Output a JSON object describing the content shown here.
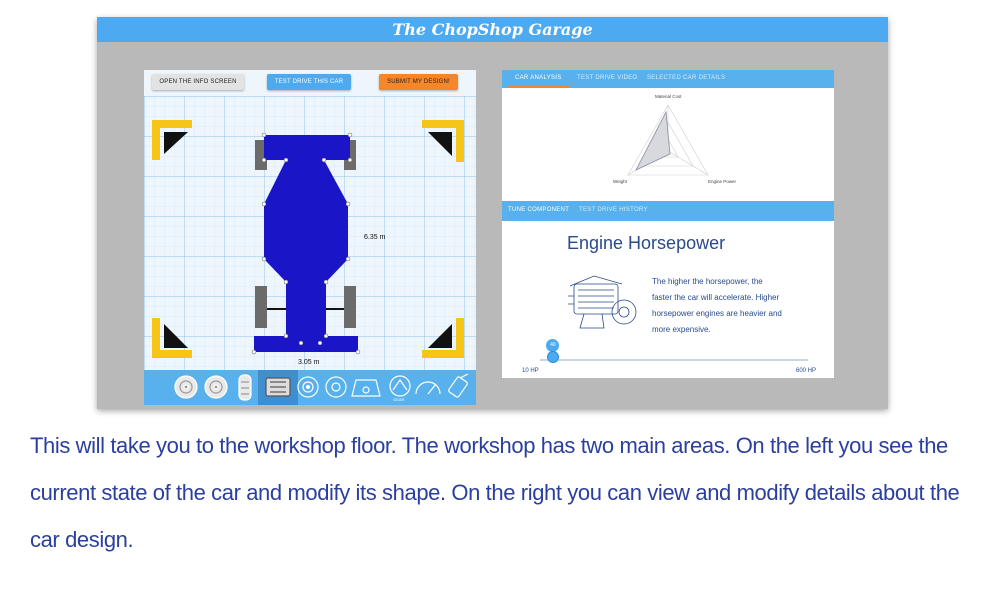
{
  "window": {
    "title": "The ChopShop Garage"
  },
  "left_panel": {
    "buttons": {
      "info": "OPEN THE INFO SCREEN",
      "drive": "TEST DRIVE THIS CAR",
      "submit": "SUBMIT MY DESIGN!"
    },
    "dimensions": {
      "length": "6.35 m",
      "width": "3.05 m"
    },
    "car_color": "#1a16c8",
    "accent_yellow": "#f5c518",
    "tools": [
      "wheel-icon",
      "wide-wheel-icon",
      "tire-icon",
      "engine-icon",
      "disc-brake-icon",
      "brake-icon",
      "steering-icon",
      "gear-icon",
      "speedometer-icon",
      "fuel-icon"
    ],
    "tool_labels": {
      "gear": "GEAR"
    }
  },
  "analysis": {
    "tabs": [
      "CAR ANALYSIS",
      "TEST DRIVE VIDEO",
      "SELECTED CAR DETAILS"
    ],
    "radar_labels": {
      "top": "Material Cost",
      "left": "Weight",
      "right": "Engine Power"
    }
  },
  "tune": {
    "tabs": [
      "TUNE COMPONENT",
      "TEST DRIVE HISTORY"
    ],
    "title": "Engine Horsepower",
    "description": "The higher the horsepower, the faster the car will accelerate. Higher horsepower engines are heavier and more expensive.",
    "slider": {
      "value": "40",
      "min_label": "10 HP",
      "max_label": "600 HP",
      "fraction": 0.05
    }
  },
  "caption": "This will take you to the workshop floor. The workshop has two main areas. On the left you see the current state of the car and modify its shape. On the right you can view and modify details about the car design."
}
